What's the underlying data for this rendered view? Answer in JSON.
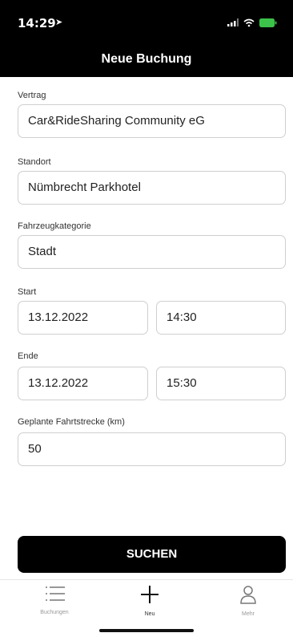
{
  "status_bar": {
    "time": "14:29",
    "battery_color": "#3cc24a"
  },
  "nav": {
    "title": "Neue Buchung"
  },
  "form": {
    "contract_label": "Vertrag",
    "contract_value": "Car&RideSharing Community eG",
    "location_label": "Standort",
    "location_value": "Nümbrecht Parkhotel",
    "category_label": "Fahrzeugkategorie",
    "category_value": "Stadt",
    "start_label": "Start",
    "start_date": "13.12.2022",
    "start_time": "14:30",
    "end_label": "Ende",
    "end_date": "13.12.2022",
    "end_time": "15:30",
    "distance_label": "Geplante Fahrtstrecke (km)",
    "distance_value": "50"
  },
  "search_button": {
    "label": "SUCHEN"
  },
  "tab_bar": {
    "tabs": [
      {
        "label": "Buchungen",
        "icon": "list-icon"
      },
      {
        "label": "Neu",
        "icon": "plus-icon"
      },
      {
        "label": "Mehr",
        "icon": "person-icon"
      }
    ]
  }
}
